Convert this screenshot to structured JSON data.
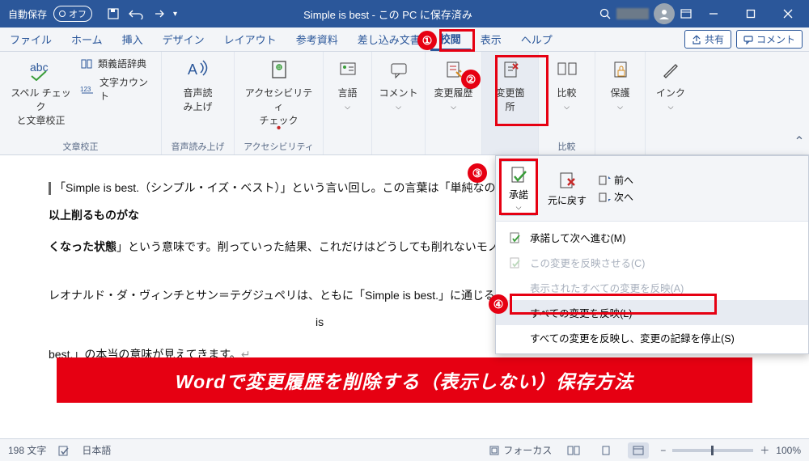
{
  "titlebar": {
    "autosave_label": "自動保存",
    "autosave_state": "オフ",
    "title": "Simple is best - この PC に保存済み"
  },
  "tabs": {
    "items": [
      "ファイル",
      "ホーム",
      "挿入",
      "デザイン",
      "レイアウト",
      "参考資料",
      "差し込み文書",
      "校閲",
      "表示",
      "ヘルプ"
    ],
    "active_index": 7,
    "share": "共有",
    "comment": "コメント"
  },
  "ribbon": {
    "proof": {
      "spell": "スペル チェック\nと文章校正",
      "thesaurus": "類義語辞典",
      "wordcount": "文字カウント",
      "group": "文章校正"
    },
    "speech": {
      "readaloud": "音声読\nみ上げ",
      "group": "音声読み上げ"
    },
    "a11y": {
      "check": "アクセシビリティ\nチェック",
      "group": "アクセシビリティ"
    },
    "lang": {
      "language": "言語"
    },
    "comment": {
      "comment": "コメント"
    },
    "tracking": {
      "track": "変更履歴",
      "changes": "変更箇\n所"
    },
    "compare": {
      "compare": "比較",
      "group": "比較"
    },
    "protect": {
      "protect": "保護"
    },
    "ink": {
      "ink": "インク"
    }
  },
  "popup": {
    "accept": "承諾",
    "reject": "元に戻す",
    "prev": "前へ",
    "next": "次へ",
    "menu": [
      "承諾して次へ進む(M)",
      "この変更を反映させる(C)",
      "表示されたすべての変更を反映(A)",
      "すべての変更を反映(L)",
      "すべての変更を反映し、変更の記録を停止(S)"
    ],
    "hover_index": 3
  },
  "doc": {
    "p1_a": "「Simple is best.（シンプル・イズ・ベスト）」という言い回し。この言葉は「単純なのが",
    "p1_b": "、「",
    "p1_bold": "これ以上削るものがな",
    "p2_bold": "くなった状態",
    "p2": "」という意味です。削っていった結果、これだけはどうしても削れないモノ。そ",
    "p3_a": "レオナルド・ダ・ヴィンチとサン＝テグジュペリは、ともに「Simple is best.」に通じる言",
    "p3_b": "is",
    "p4": "best.」の本当の意味が見えてきます。"
  },
  "banner": "Wordで変更履歴を削除する（表示しない）保存方法",
  "status": {
    "wordcount": "198 文字",
    "lang": "日本語",
    "focus": "フォーカス",
    "zoom": "100%"
  },
  "annotations": [
    "①",
    "②",
    "③",
    "④"
  ]
}
